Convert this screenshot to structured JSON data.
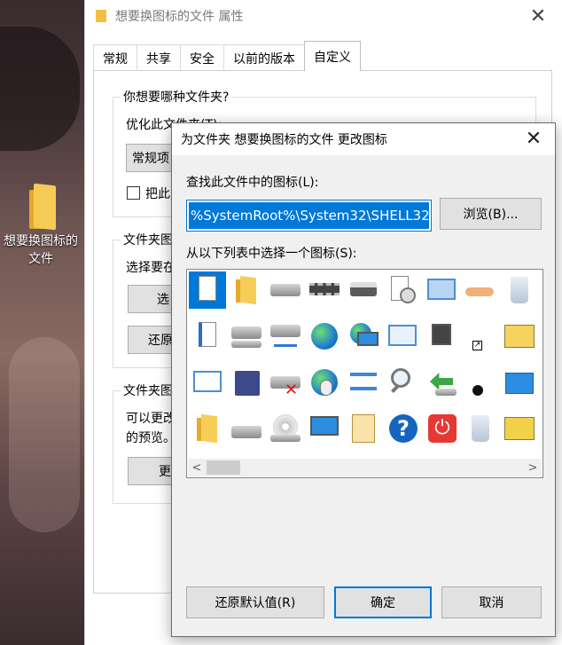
{
  "desktop": {
    "icon_label": "想要换图标的文件"
  },
  "properties": {
    "title": "想要换图标的文件 属性",
    "tabs": [
      "常规",
      "共享",
      "安全",
      "以前的版本",
      "自定义"
    ],
    "group1_title": "你想要哪种文件夹?",
    "group1_optimize_label": "优化此文件夹(T):",
    "group1_dropdown": "常规项",
    "group1_checkbox_label": "把此",
    "group2_title": "文件夹图",
    "group2_text": "选择要在",
    "group2_btn1": "选",
    "group2_btn2": "还原",
    "group3_title": "文件夹图",
    "group3_text1": "可以更改",
    "group3_text2": "的预览。",
    "group3_btn": "更"
  },
  "dialog": {
    "title": "为文件夹 想要换图标的文件 更改图标",
    "find_label": "查找此文件中的图标(L):",
    "path_value": "%SystemRoot%\\System32\\SHELL32.dll",
    "browse_label": "浏览(B)...",
    "list_label": "从以下列表中选择一个图标(S):",
    "restore_label": "还原默认值(R)",
    "ok_label": "确定",
    "cancel_label": "取消"
  },
  "icons": [
    [
      "blank-document-icon",
      "folder-icon",
      "drive-icon",
      "memory-chip-icon",
      "printer-icon",
      "clock-document-icon",
      "window-icon",
      "share-hand-icon",
      "recycle-bin-full-icon"
    ],
    [
      "text-document-icon",
      "network-drive-icon",
      "network-drive2-icon",
      "internet-globe-icon",
      "network-globe-icon",
      "control-panel-icon",
      "media-icon",
      "shortcut-arrow-icon",
      "tools-folder-icon"
    ],
    [
      "application-window-icon",
      "floppy-icon",
      "disconnected-drive-icon",
      "globe-mouse-icon",
      "network-nodes-icon",
      "search-icon",
      "arrow-drive-icon",
      "clock-small-icon",
      "blue-screen-icon"
    ],
    [
      "folder-small-icon",
      "hard-drive-icon",
      "cd-drive-icon",
      "computer-icon",
      "grid-document-icon",
      "help-icon",
      "power-icon",
      "recycle-bin-icon",
      "tools-icon"
    ]
  ]
}
